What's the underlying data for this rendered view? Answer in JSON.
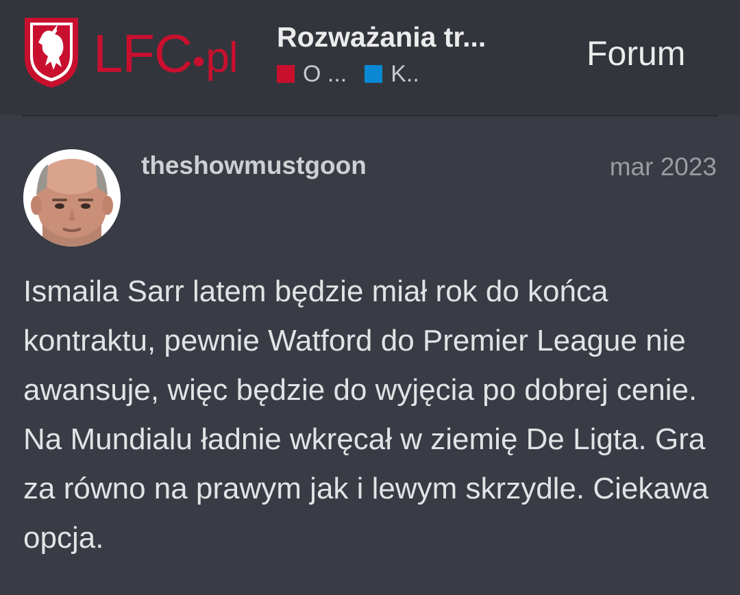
{
  "header": {
    "logo": {
      "text_main": "LFC",
      "text_tld": "pl",
      "brand_color": "#c8102e"
    },
    "topic_title": "Rozważania tr...",
    "categories": [
      {
        "label": "O ...",
        "color": "#c8102e"
      },
      {
        "label": "K..",
        "color": "#0a88d4"
      }
    ],
    "forum_label": "Forum"
  },
  "post": {
    "username": "theshowmustgoon",
    "date": "mar 2023",
    "body": "Ismaila Sarr latem będzie miał rok do końca kontraktu, pewnie Watford do Premier League nie awansuje, więc będzie do wyjęcia po dobrej cenie. Na Mundialu ładnie wkręcał w ziemię De Ligta. Gra za równo na prawym jak i lewym skrzydle. Ciekawa opcja."
  }
}
